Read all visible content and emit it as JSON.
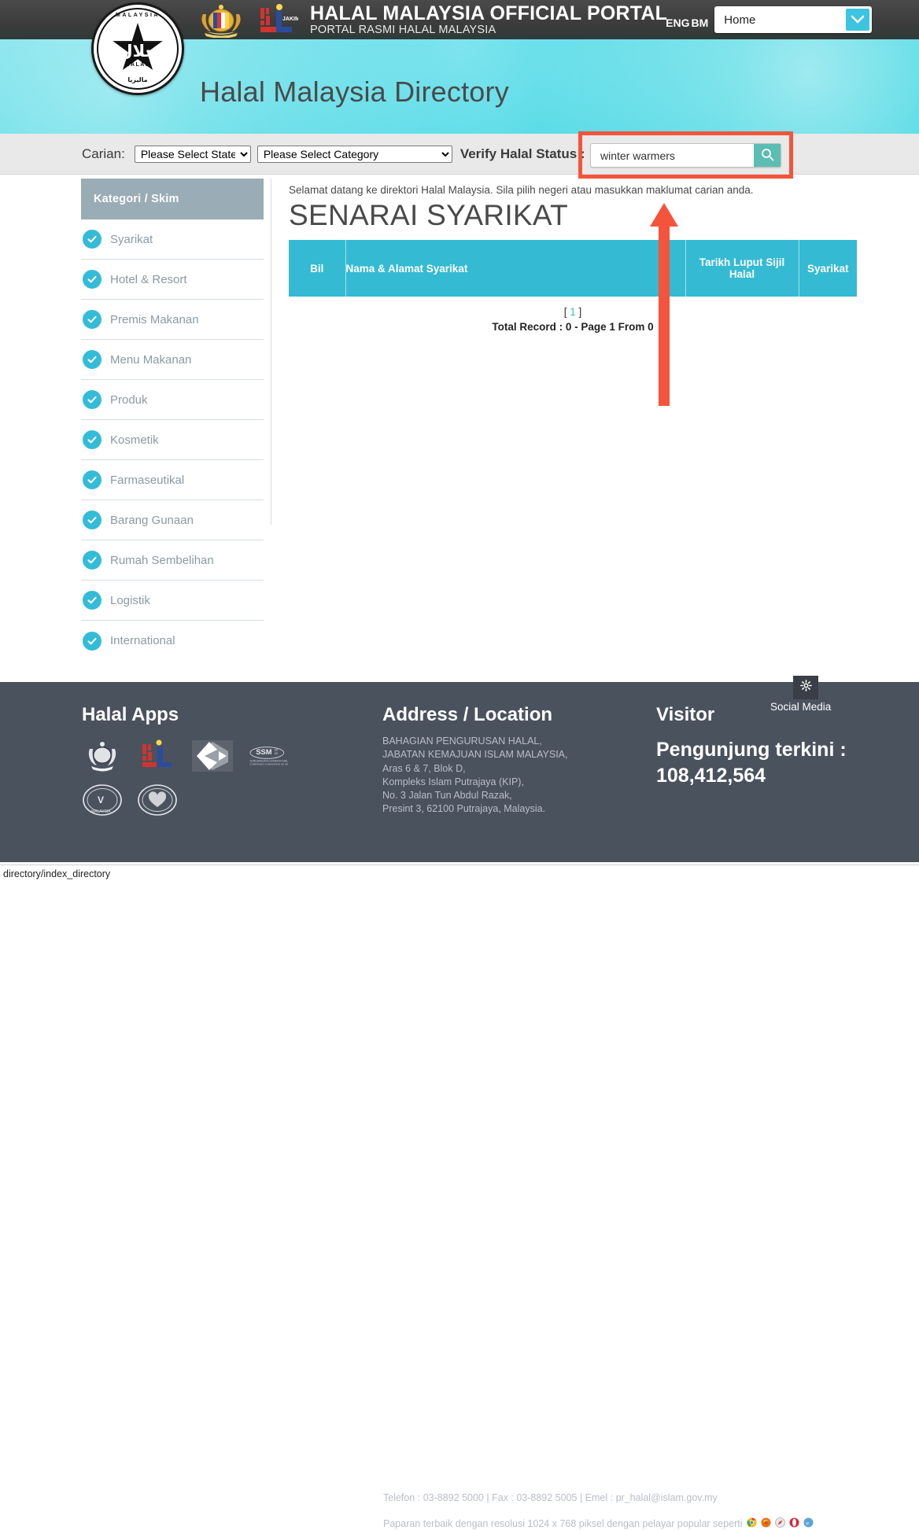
{
  "header": {
    "portal_title": "HALAL MALAYSIA OFFICIAL PORTAL",
    "portal_subtitle": "PORTAL RASMI HALAL MALAYSIA",
    "lang_eng": "ENG",
    "lang_bm": "BM",
    "nav_select_value": "Home",
    "emblem": {
      "top_word": "MALAYSIA",
      "center_word": "HALAL",
      "bottom_word": "ماليزيا",
      "arabic": "حلال"
    },
    "jakim_label": "JAKIM"
  },
  "banner": {
    "title": "Halal Malaysia Directory"
  },
  "searchbar": {
    "carian_label": "Carian:",
    "state_select_value": "Please Select State",
    "state_options": [
      "Please Select State"
    ],
    "category_select_value": "Please Select Category",
    "category_options": [
      "Please Select Category"
    ],
    "verify_label": "Verify Halal Status :",
    "search_value": "winter warmers",
    "search_placeholder": "",
    "search_icon": "search-icon",
    "highlight_color": "#f4543c",
    "search_button_color": "#5cbdb2"
  },
  "sidebar": {
    "header": "Kategori / Skim",
    "header_color": "#9aacb5",
    "check_color": "#33bcd8",
    "items": [
      {
        "label": "Syarikat"
      },
      {
        "label": "Hotel & Resort"
      },
      {
        "label": "Premis Makanan"
      },
      {
        "label": "Menu Makanan"
      },
      {
        "label": "Produk"
      },
      {
        "label": "Kosmetik"
      },
      {
        "label": "Farmaseutikal"
      },
      {
        "label": "Barang Gunaan"
      },
      {
        "label": "Rumah Sembelihan"
      },
      {
        "label": "Logistik"
      },
      {
        "label": "International"
      }
    ]
  },
  "main": {
    "welcome": "Selamat datang ke direktori Halal Malaysia. Sila pilih negeri atau masukkan maklumat carian anda.",
    "page_title": "SENARAI SYARIKAT",
    "table": {
      "header_color": "#35bad4",
      "columns": [
        "Bil",
        "Nama & Alamat Syarikat",
        "Tarikh Luput Sijil Halal",
        "Syarikat"
      ],
      "rows": [],
      "pager_open": "[",
      "pager_page": "1",
      "pager_close": "]",
      "total_record": "Total Record : 0 - Page 1 From 0"
    }
  },
  "annotation": {
    "arrow_color": "#f4543c",
    "arrow_name": "red-up-arrow-annotation"
  },
  "footer": {
    "apps_heading": "Halal Apps",
    "app_logos": [
      "jata-negara-logo",
      "jakim-logo",
      "mygov-logo",
      "ssm-logo",
      "veterinary-services-logo",
      "heart-foundation-logo"
    ],
    "address_heading": "Address / Location",
    "address_lines": [
      "BAHAGIAN PENGURUSAN HALAL,",
      "JABATAN KEMAJUAN ISLAM MALAYSIA,",
      "Aras 6 & 7, Blok D,",
      "Kompleks Islam Putrajaya (KIP),",
      "No. 3 Jalan Tun Abdul Razak,",
      "Presint 3, 62100 Putrajaya, Malaysia."
    ],
    "contact_line": "Telefon : 03-8892 5000 | Fax : 03-8892 5005 | Emel : pr_halal@islam.gov.my",
    "browser_line": "Paparan terbaik dengan resolusi 1024 x 768 piksel dengan pelayar popular seperti",
    "browser_icons": [
      "chrome-icon",
      "firefox-icon",
      "safari-icon",
      "opera-icon",
      "internet-explorer-icon"
    ],
    "visitor_heading": "Visitor",
    "visitor_sub_label": "Pengunjung terkini :",
    "visitor_count": "108,412,564",
    "social_media_label": "Social Media",
    "social_media_icon": "gear-icon",
    "background_color": "#4a525e"
  },
  "statusbar": {
    "text": "directory/index_directory"
  }
}
